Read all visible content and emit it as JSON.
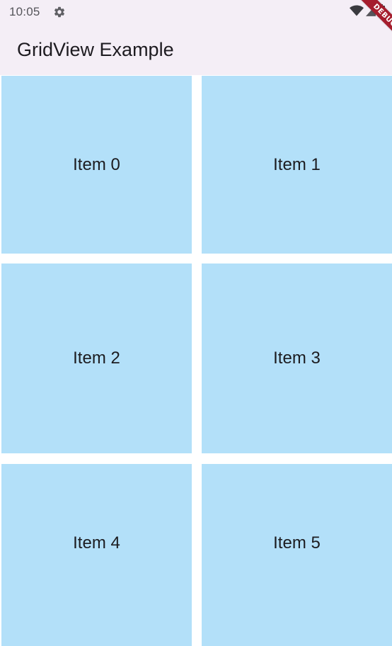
{
  "status_bar": {
    "time": "10:05",
    "icons": [
      "settings-icon",
      "wifi-icon",
      "signal-icon",
      "battery-icon"
    ]
  },
  "app_bar": {
    "title": "GridView Example",
    "background": "#f4eef6"
  },
  "grid": {
    "columns": 2,
    "tile_color": "#b3e0f9",
    "items": [
      {
        "label": "Item 0"
      },
      {
        "label": "Item 1"
      },
      {
        "label": "Item 2"
      },
      {
        "label": "Item 3"
      },
      {
        "label": "Item 4"
      },
      {
        "label": "Item 5"
      }
    ]
  },
  "debug_banner": {
    "text": "DEBUG",
    "color": "#a51d2d"
  }
}
